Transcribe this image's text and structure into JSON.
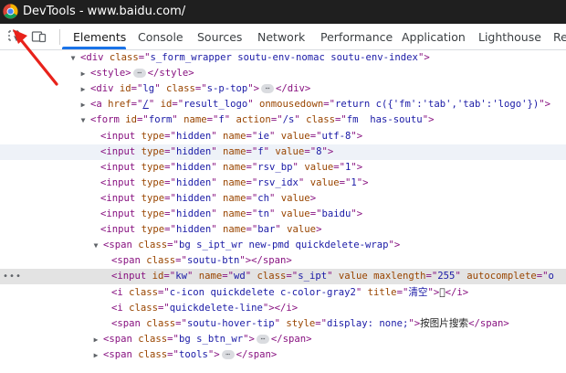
{
  "window": {
    "title": "DevTools - www.baidu.com/"
  },
  "toolbar": {
    "inspect_icon": "inspect-element-icon",
    "device_icon": "device-toolbar-icon",
    "tabs": [
      {
        "label": "Elements"
      },
      {
        "label": "Console"
      },
      {
        "label": "Sources"
      },
      {
        "label": "Network"
      },
      {
        "label": "Performance"
      },
      {
        "label": "Application"
      },
      {
        "label": "Lighthouse"
      },
      {
        "label": "Re"
      }
    ],
    "active_tab": "Elements"
  },
  "tree": {
    "rows": [
      {
        "segments": [
          [
            "tag",
            "<div "
          ],
          [
            "an",
            "class"
          ],
          [
            "tag",
            "=\""
          ],
          [
            "av",
            "s_form_wrapper soutu-env-nomac soutu-env-index"
          ],
          [
            "tag",
            "\">"
          ]
        ]
      },
      {
        "segments": [
          [
            "tag",
            "<style>"
          ],
          [
            "ell",
            ""
          ],
          [
            "tag",
            "</style>"
          ]
        ]
      },
      {
        "segments": [
          [
            "tag",
            "<div "
          ],
          [
            "an",
            "id"
          ],
          [
            "tag",
            "=\""
          ],
          [
            "av",
            "lg"
          ],
          [
            "tag",
            "\" "
          ],
          [
            "an",
            "class"
          ],
          [
            "tag",
            "=\""
          ],
          [
            "av",
            "s-p-top"
          ],
          [
            "tag",
            "\">"
          ],
          [
            "ell",
            ""
          ],
          [
            "tag",
            "</div>"
          ]
        ]
      },
      {
        "segments": [
          [
            "tag",
            "<a "
          ],
          [
            "an",
            "href"
          ],
          [
            "tag",
            "=\""
          ],
          [
            "avu",
            "/"
          ],
          [
            "tag",
            "\" "
          ],
          [
            "an",
            "id"
          ],
          [
            "tag",
            "=\""
          ],
          [
            "av",
            "result_logo"
          ],
          [
            "tag",
            "\" "
          ],
          [
            "an",
            "onmousedown"
          ],
          [
            "tag",
            "=\""
          ],
          [
            "av",
            "return c({'fm':'tab','tab':'logo'})"
          ],
          [
            "tag",
            "\">"
          ]
        ]
      },
      {
        "segments": [
          [
            "tag",
            "<form "
          ],
          [
            "an",
            "id"
          ],
          [
            "tag",
            "=\""
          ],
          [
            "av",
            "form"
          ],
          [
            "tag",
            "\" "
          ],
          [
            "an",
            "name"
          ],
          [
            "tag",
            "=\""
          ],
          [
            "av",
            "f"
          ],
          [
            "tag",
            "\" "
          ],
          [
            "an",
            "action"
          ],
          [
            "tag",
            "=\""
          ],
          [
            "av",
            "/s"
          ],
          [
            "tag",
            "\" "
          ],
          [
            "an",
            "class"
          ],
          [
            "tag",
            "=\""
          ],
          [
            "av",
            "fm  has-soutu"
          ],
          [
            "tag",
            "\">"
          ]
        ]
      },
      {
        "segments": [
          [
            "tag",
            "<input "
          ],
          [
            "an",
            "type"
          ],
          [
            "tag",
            "=\""
          ],
          [
            "av",
            "hidden"
          ],
          [
            "tag",
            "\" "
          ],
          [
            "an",
            "name"
          ],
          [
            "tag",
            "=\""
          ],
          [
            "av",
            "ie"
          ],
          [
            "tag",
            "\" "
          ],
          [
            "an",
            "value"
          ],
          [
            "tag",
            "=\""
          ],
          [
            "av",
            "utf-8"
          ],
          [
            "tag",
            "\">"
          ]
        ]
      },
      {
        "segments": [
          [
            "tag",
            "<input "
          ],
          [
            "an",
            "type"
          ],
          [
            "tag",
            "=\""
          ],
          [
            "av",
            "hidden"
          ],
          [
            "tag",
            "\" "
          ],
          [
            "an",
            "name"
          ],
          [
            "tag",
            "=\""
          ],
          [
            "av",
            "f"
          ],
          [
            "tag",
            "\" "
          ],
          [
            "an",
            "value"
          ],
          [
            "tag",
            "=\""
          ],
          [
            "av",
            "8"
          ],
          [
            "tag",
            "\">"
          ]
        ]
      },
      {
        "segments": [
          [
            "tag",
            "<input "
          ],
          [
            "an",
            "type"
          ],
          [
            "tag",
            "=\""
          ],
          [
            "av",
            "hidden"
          ],
          [
            "tag",
            "\" "
          ],
          [
            "an",
            "name"
          ],
          [
            "tag",
            "=\""
          ],
          [
            "av",
            "rsv_bp"
          ],
          [
            "tag",
            "\" "
          ],
          [
            "an",
            "value"
          ],
          [
            "tag",
            "=\""
          ],
          [
            "av",
            "1"
          ],
          [
            "tag",
            "\">"
          ]
        ]
      },
      {
        "segments": [
          [
            "tag",
            "<input "
          ],
          [
            "an",
            "type"
          ],
          [
            "tag",
            "=\""
          ],
          [
            "av",
            "hidden"
          ],
          [
            "tag",
            "\" "
          ],
          [
            "an",
            "name"
          ],
          [
            "tag",
            "=\""
          ],
          [
            "av",
            "rsv_idx"
          ],
          [
            "tag",
            "\" "
          ],
          [
            "an",
            "value"
          ],
          [
            "tag",
            "=\""
          ],
          [
            "av",
            "1"
          ],
          [
            "tag",
            "\">"
          ]
        ]
      },
      {
        "segments": [
          [
            "tag",
            "<input "
          ],
          [
            "an",
            "type"
          ],
          [
            "tag",
            "=\""
          ],
          [
            "av",
            "hidden"
          ],
          [
            "tag",
            "\" "
          ],
          [
            "an",
            "name"
          ],
          [
            "tag",
            "=\""
          ],
          [
            "av",
            "ch"
          ],
          [
            "tag",
            "\" "
          ],
          [
            "an",
            "value"
          ],
          [
            "tag",
            ">"
          ]
        ]
      },
      {
        "segments": [
          [
            "tag",
            "<input "
          ],
          [
            "an",
            "type"
          ],
          [
            "tag",
            "=\""
          ],
          [
            "av",
            "hidden"
          ],
          [
            "tag",
            "\" "
          ],
          [
            "an",
            "name"
          ],
          [
            "tag",
            "=\""
          ],
          [
            "av",
            "tn"
          ],
          [
            "tag",
            "\" "
          ],
          [
            "an",
            "value"
          ],
          [
            "tag",
            "=\""
          ],
          [
            "av",
            "baidu"
          ],
          [
            "tag",
            "\">"
          ]
        ]
      },
      {
        "segments": [
          [
            "tag",
            "<input "
          ],
          [
            "an",
            "type"
          ],
          [
            "tag",
            "=\""
          ],
          [
            "av",
            "hidden"
          ],
          [
            "tag",
            "\" "
          ],
          [
            "an",
            "name"
          ],
          [
            "tag",
            "=\""
          ],
          [
            "av",
            "bar"
          ],
          [
            "tag",
            "\" "
          ],
          [
            "an",
            "value"
          ],
          [
            "tag",
            ">"
          ]
        ]
      },
      {
        "segments": [
          [
            "tag",
            "<span "
          ],
          [
            "an",
            "class"
          ],
          [
            "tag",
            "=\""
          ],
          [
            "av",
            "bg s_ipt_wr new-pmd quickdelete-wrap"
          ],
          [
            "tag",
            "\">"
          ]
        ]
      },
      {
        "segments": [
          [
            "tag",
            "<span "
          ],
          [
            "an",
            "class"
          ],
          [
            "tag",
            "=\""
          ],
          [
            "av",
            "soutu-btn"
          ],
          [
            "tag",
            "\"></span>"
          ]
        ]
      },
      {
        "segments": [
          [
            "tag",
            "<input "
          ],
          [
            "an",
            "id"
          ],
          [
            "tag",
            "=\""
          ],
          [
            "av",
            "kw"
          ],
          [
            "tag",
            "\" "
          ],
          [
            "an",
            "name"
          ],
          [
            "tag",
            "=\""
          ],
          [
            "av",
            "wd"
          ],
          [
            "tag",
            "\" "
          ],
          [
            "an",
            "class"
          ],
          [
            "tag",
            "=\""
          ],
          [
            "av",
            "s_ipt"
          ],
          [
            "tag",
            "\" "
          ],
          [
            "an",
            "value"
          ],
          [
            "tag",
            " "
          ],
          [
            "an",
            "maxlength"
          ],
          [
            "tag",
            "=\""
          ],
          [
            "av",
            "255"
          ],
          [
            "tag",
            "\" "
          ],
          [
            "an",
            "autocomplete"
          ],
          [
            "tag",
            "=\""
          ],
          [
            "av",
            "o"
          ]
        ]
      },
      {
        "segments": [
          [
            "tag",
            "<i "
          ],
          [
            "an",
            "class"
          ],
          [
            "tag",
            "=\""
          ],
          [
            "av",
            "c-icon quickdelete c-color-gray2"
          ],
          [
            "tag",
            "\" "
          ],
          [
            "an",
            "title"
          ],
          [
            "tag",
            "=\""
          ],
          [
            "av",
            "清空"
          ],
          [
            "tag",
            "\">"
          ],
          [
            "txt",
            ""
          ],
          [
            "tag",
            "</i>"
          ]
        ]
      },
      {
        "segments": [
          [
            "tag",
            "<i "
          ],
          [
            "an",
            "class"
          ],
          [
            "tag",
            "=\""
          ],
          [
            "av",
            "quickdelete-line"
          ],
          [
            "tag",
            "\"></i>"
          ]
        ]
      },
      {
        "segments": [
          [
            "tag",
            "<span "
          ],
          [
            "an",
            "class"
          ],
          [
            "tag",
            "=\""
          ],
          [
            "av",
            "soutu-hover-tip"
          ],
          [
            "tag",
            "\" "
          ],
          [
            "an",
            "style"
          ],
          [
            "tag",
            "=\""
          ],
          [
            "av",
            "display: none;"
          ],
          [
            "tag",
            "\">"
          ],
          [
            "txt",
            "按图片搜索"
          ],
          [
            "tag",
            "</span>"
          ]
        ]
      },
      {
        "segments": [
          [
            "tag",
            "<span "
          ],
          [
            "an",
            "class"
          ],
          [
            "tag",
            "=\""
          ],
          [
            "av",
            "bg s_btn_wr"
          ],
          [
            "tag",
            "\">"
          ],
          [
            "ell",
            ""
          ],
          [
            "tag",
            "</span>"
          ]
        ]
      },
      {
        "segments": [
          [
            "tag",
            "<span "
          ],
          [
            "an",
            "class"
          ],
          [
            "tag",
            "=\""
          ],
          [
            "av",
            "tools"
          ],
          [
            "tag",
            "\">"
          ],
          [
            "ell",
            ""
          ],
          [
            "tag",
            "</span>"
          ]
        ]
      }
    ]
  }
}
